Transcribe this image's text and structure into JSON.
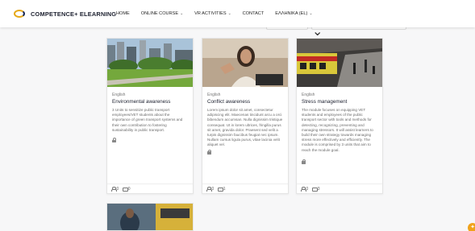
{
  "header": {
    "logo_text": "COMPETENCE+ ELEARNING",
    "nav": [
      {
        "label": "HOME",
        "has_dropdown": false
      },
      {
        "label": "ONLINE COURSE",
        "has_dropdown": true
      },
      {
        "label": "VR ACTIVITIES",
        "has_dropdown": true
      },
      {
        "label": "CONTACT",
        "has_dropdown": false
      },
      {
        "label": "ΕΛΛΗΝΙΚΑ (EL)",
        "has_dropdown": true
      }
    ]
  },
  "courses": [
    {
      "language": "English",
      "title": "Environmental awareness",
      "description": "3 Units to sensitize public transport employees/VET students about the importance of green transport systems and their own contribution to fostering sustainability in public transport.",
      "participants": "0",
      "comments": "0",
      "image": "city-park-scene"
    },
    {
      "language": "English",
      "title": "Conflict awareness",
      "description": "Lorem ipsum dolor sit amet, consectetur adipiscing elit. Maecenas tincidunt arcu a orci bibendum accumsan. Nulla dignissim tristique consequat. Ut in lorem ultrices, fringilla purus sit amet, gravida dolor. Praesent sed velit a turpis dignissim faucibus feugiat nec ipsum. Nullam cursus ligula purus, vitae lacinia velit aliquet vel.",
      "participants": "0",
      "comments": "1",
      "image": "woman-laptop-scene"
    },
    {
      "language": "English",
      "title": "Stress management",
      "description": "The module focuses on equipping VET students and employees of the public transport sector with tools and methods for detecting, recognizing, preventing and managing stressors. It will assist learners to build their own strategy towards managing stress more effectively and efficiently. The module is comprised by 3 units that aim to reach the module goal.",
      "participants": "0",
      "comments": "3",
      "image": "train-station-scene"
    }
  ],
  "colors": {
    "accent": "#f0a21b",
    "brand_dark": "#1b2a55"
  }
}
